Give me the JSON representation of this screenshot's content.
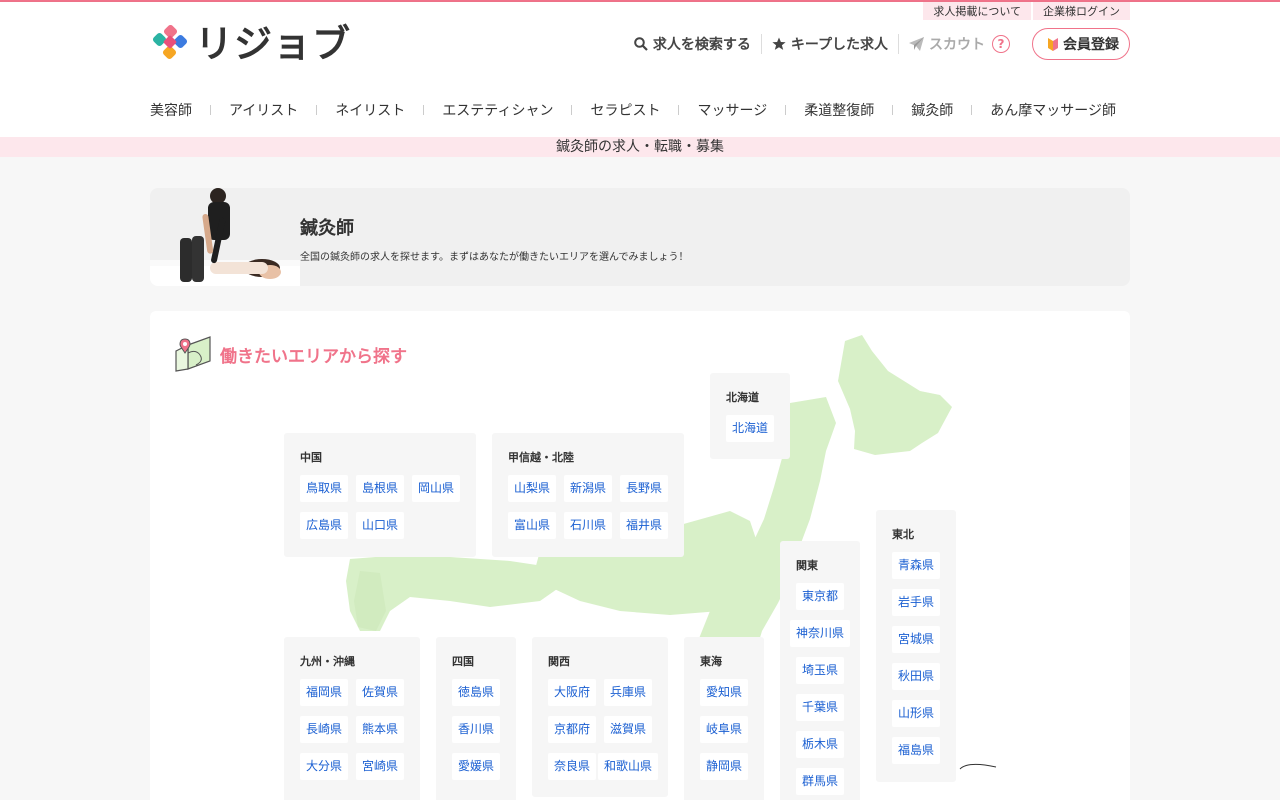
{
  "brand": {
    "name": "リジョブ"
  },
  "top_links": [
    "求人掲載について",
    "企業様ログイン"
  ],
  "utility_nav": {
    "search": "求人を検索する",
    "kept": "キープした求人",
    "scout": "スカウト",
    "help": "?",
    "register": "会員登録"
  },
  "categories": [
    "美容師",
    "アイリスト",
    "ネイリスト",
    "エステティシャン",
    "セラピスト",
    "マッサージ",
    "柔道整復師",
    "鍼灸師",
    "あん摩マッサージ師"
  ],
  "banner": "鍼灸師の求人・転職・募集",
  "hero": {
    "title": "鍼灸師",
    "description": "全国の鍼灸師の求人を探せます。まずはあなたが働きたいエリアを選んでみましょう！"
  },
  "area_section": {
    "title": "働きたいエリアから探す"
  },
  "regions": {
    "hokkaido": {
      "name": "北海道",
      "prefs": [
        "北海道"
      ]
    },
    "chugoku": {
      "name": "中国",
      "prefs": [
        "鳥取県",
        "島根県",
        "岡山県",
        "広島県",
        "山口県"
      ]
    },
    "koshinetsu": {
      "name": "甲信越・北陸",
      "prefs": [
        "山梨県",
        "新潟県",
        "長野県",
        "富山県",
        "石川県",
        "福井県"
      ]
    },
    "tohoku": {
      "name": "東北",
      "prefs": [
        "青森県",
        "岩手県",
        "宮城県",
        "秋田県",
        "山形県",
        "福島県"
      ]
    },
    "kanto": {
      "name": "関東",
      "prefs": [
        "東京都",
        "神奈川県",
        "埼玉県",
        "千葉県",
        "栃木県",
        "群馬県"
      ]
    },
    "kyushu": {
      "name": "九州・沖縄",
      "prefs": [
        "福岡県",
        "佐賀県",
        "長崎県",
        "熊本県",
        "大分県",
        "宮崎県"
      ]
    },
    "shikoku": {
      "name": "四国",
      "prefs": [
        "徳島県",
        "香川県",
        "愛媛県"
      ]
    },
    "kansai": {
      "name": "関西",
      "prefs": [
        "大阪府",
        "兵庫県",
        "京都府",
        "滋賀県",
        "奈良県",
        "和歌山県"
      ]
    },
    "tokai": {
      "name": "東海",
      "prefs": [
        "愛知県",
        "岐阜県",
        "静岡県"
      ]
    }
  },
  "colors": {
    "accent": "#f0738a",
    "link": "#1a5fd2",
    "map_land": "#d8f0c8",
    "banner_bg": "#fde7ec"
  }
}
